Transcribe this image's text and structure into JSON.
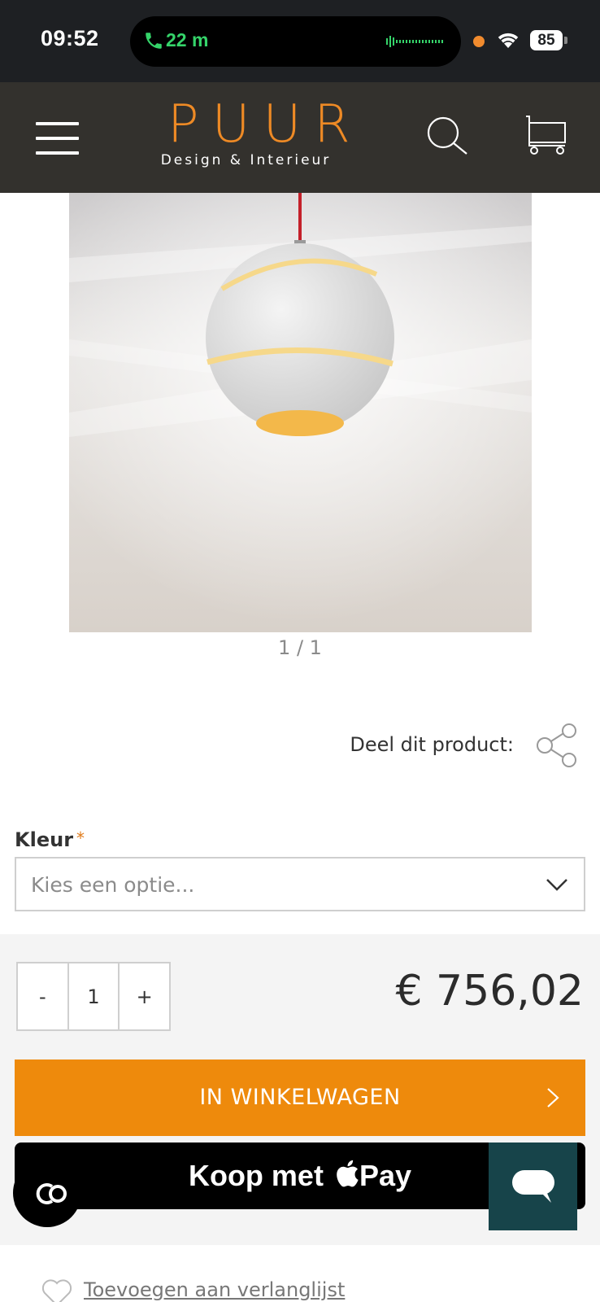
{
  "status_bar": {
    "time": "09:52",
    "call_duration": "22 m",
    "battery": "85"
  },
  "header": {
    "logo_main": "PUUR",
    "logo_sub": "Design & Interieur"
  },
  "gallery": {
    "counter": "1 / 1"
  },
  "share": {
    "label": "Deel dit product:"
  },
  "options": {
    "kleur_label": "Kleur",
    "required_mark": "*",
    "select_placeholder": "Kies een optie..."
  },
  "buy": {
    "qty_minus": "-",
    "qty_value": "1",
    "qty_plus": "+",
    "price": "€ 756,02",
    "add_to_cart": "IN WINKELWAGEN",
    "apple_pay_prefix": "Koop met",
    "apple_pay_suffix": "Pay"
  },
  "wishlist": {
    "label": "Toevoegen aan verlanglijst"
  },
  "colors": {
    "accent": "#ee8a0c",
    "header_bg": "#33312d",
    "chat_bg": "#17444a"
  }
}
